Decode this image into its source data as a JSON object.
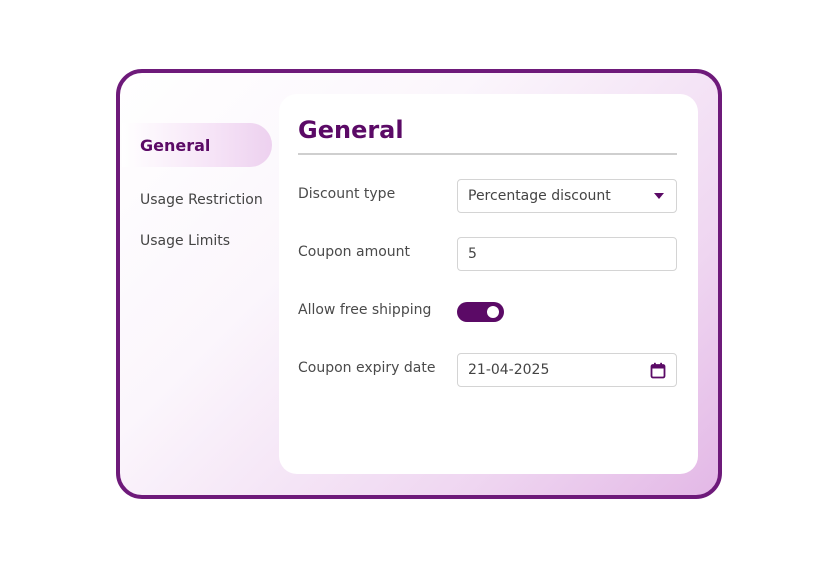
{
  "sidebar": {
    "items": [
      {
        "label": "General",
        "active": true
      },
      {
        "label": "Usage Restriction",
        "active": false
      },
      {
        "label": "Usage Limits",
        "active": false
      }
    ]
  },
  "panel": {
    "title": "General",
    "fields": {
      "discount_type": {
        "label": "Discount type",
        "value": "Percentage discount"
      },
      "coupon_amount": {
        "label": "Coupon amount",
        "value": "5"
      },
      "free_shipping": {
        "label": "Allow free shipping",
        "enabled": true
      },
      "expiry_date": {
        "label": "Coupon expiry date",
        "value": "21-04-2025"
      }
    }
  },
  "colors": {
    "accent": "#5b0a66",
    "frame_border": "#6e1a7a"
  },
  "icons": {
    "dropdown": "caret-down-icon",
    "calendar": "calendar-icon"
  }
}
